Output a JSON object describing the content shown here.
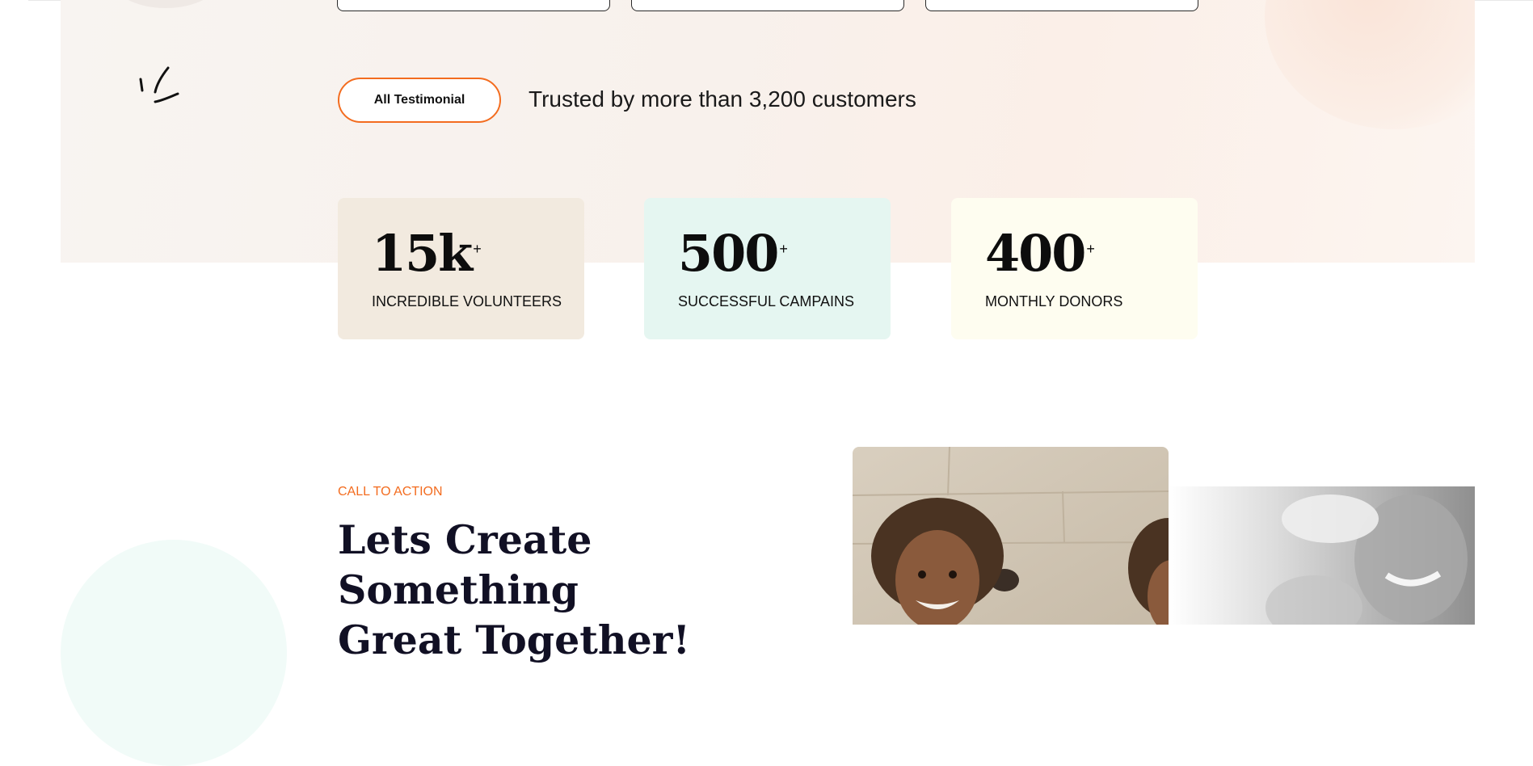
{
  "testimonial": {
    "button_label": "All Testimonial",
    "trusted_text": "Trusted by more than 3,200 customers"
  },
  "stats": [
    {
      "number": "15k",
      "suffix": "+",
      "label": "INCREDIBLE VOLUNTEERS",
      "bg": "#f2eadf"
    },
    {
      "number": "500",
      "suffix": "+",
      "label": "SUCCESSFUL CAMPAINS",
      "bg": "#e5f6f1"
    },
    {
      "number": "400",
      "suffix": "+",
      "label": "MONTHLY DONORS",
      "bg": "#fefdf0"
    }
  ],
  "cta": {
    "eyebrow": "CALL TO ACTION",
    "title_line1": "Lets Create Something",
    "title_line2": "Great Together!"
  },
  "colors": {
    "accent": "#f36c1f",
    "heading": "#111024"
  }
}
